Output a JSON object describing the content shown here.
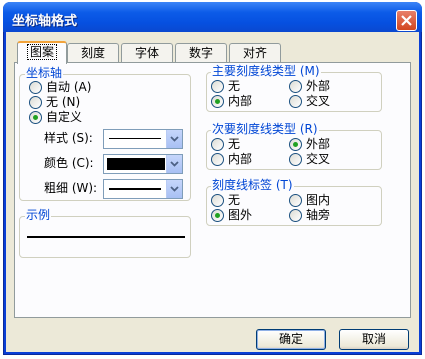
{
  "window": {
    "title": "坐标轴格式"
  },
  "tabs": [
    {
      "label": "图案",
      "active": true
    },
    {
      "label": "刻度",
      "active": false
    },
    {
      "label": "字体",
      "active": false
    },
    {
      "label": "数字",
      "active": false
    },
    {
      "label": "对齐",
      "active": false
    }
  ],
  "axis_group": {
    "title": "坐标轴",
    "options": [
      {
        "label": "自动 (A)",
        "checked": false
      },
      {
        "label": "无 (N)",
        "checked": false
      },
      {
        "label": "自定义",
        "checked": true
      }
    ],
    "style_label": "样式 (S):",
    "color_label": "颜色 (C):",
    "weight_label": "粗细 (W):",
    "color_value": "#000000"
  },
  "sample_group": {
    "title": "示例"
  },
  "major_tick": {
    "title": "主要刻度线类型 (M)",
    "options": [
      {
        "label": "无",
        "checked": false
      },
      {
        "label": "外部",
        "checked": false
      },
      {
        "label": "内部",
        "checked": true
      },
      {
        "label": "交叉",
        "checked": false
      }
    ]
  },
  "minor_tick": {
    "title": "次要刻度线类型 (R)",
    "options": [
      {
        "label": "无",
        "checked": false
      },
      {
        "label": "外部",
        "checked": true
      },
      {
        "label": "内部",
        "checked": false
      },
      {
        "label": "交叉",
        "checked": false
      }
    ]
  },
  "tick_labels": {
    "title": "刻度线标签 (T)",
    "options": [
      {
        "label": "无",
        "checked": false
      },
      {
        "label": "图内",
        "checked": false
      },
      {
        "label": "图外",
        "checked": true
      },
      {
        "label": "轴旁",
        "checked": false
      }
    ]
  },
  "buttons": {
    "ok": "确定",
    "cancel": "取消"
  }
}
